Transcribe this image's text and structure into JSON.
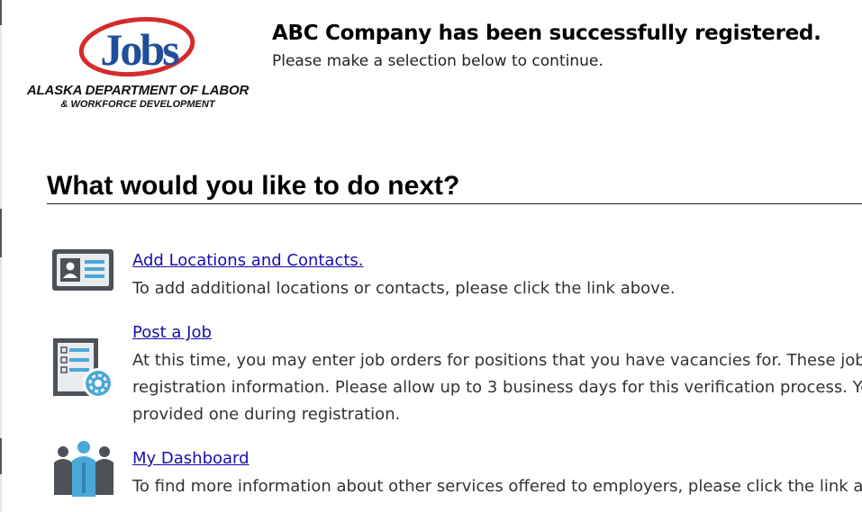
{
  "logo": {
    "wordmark": "Jobs",
    "department": "ALASKA DEPARTMENT OF LABOR",
    "subdepartment": "& WORKFORCE DEVELOPMENT"
  },
  "header": {
    "title": "ABC Company has been successfully registered.",
    "subtitle": "Please make a selection below to continue."
  },
  "main": {
    "heading": "What would you like to do next?",
    "options": [
      {
        "icon": "contact-card-icon",
        "link": "Add Locations and Contacts.",
        "lines": [
          "To add additional locations or contacts, please click the link above."
        ]
      },
      {
        "icon": "job-order-settings-icon",
        "link": "Post a Job",
        "lines": [
          "At this time, you may enter job orders for positions that you have vacancies for. These job or",
          "registration information. Please allow up to 3 business days for this verification process. You",
          "provided one during registration."
        ]
      },
      {
        "icon": "people-group-icon",
        "link": "My Dashboard",
        "lines": [
          "To find more information about other services offered to employers, please click the link abo"
        ]
      }
    ]
  },
  "colors": {
    "link": "#1a0dab",
    "logo_red": "#d62b2b",
    "logo_blue": "#1f4e9a",
    "icon_blue": "#4aa8d8",
    "icon_gray": "#4d5258"
  }
}
